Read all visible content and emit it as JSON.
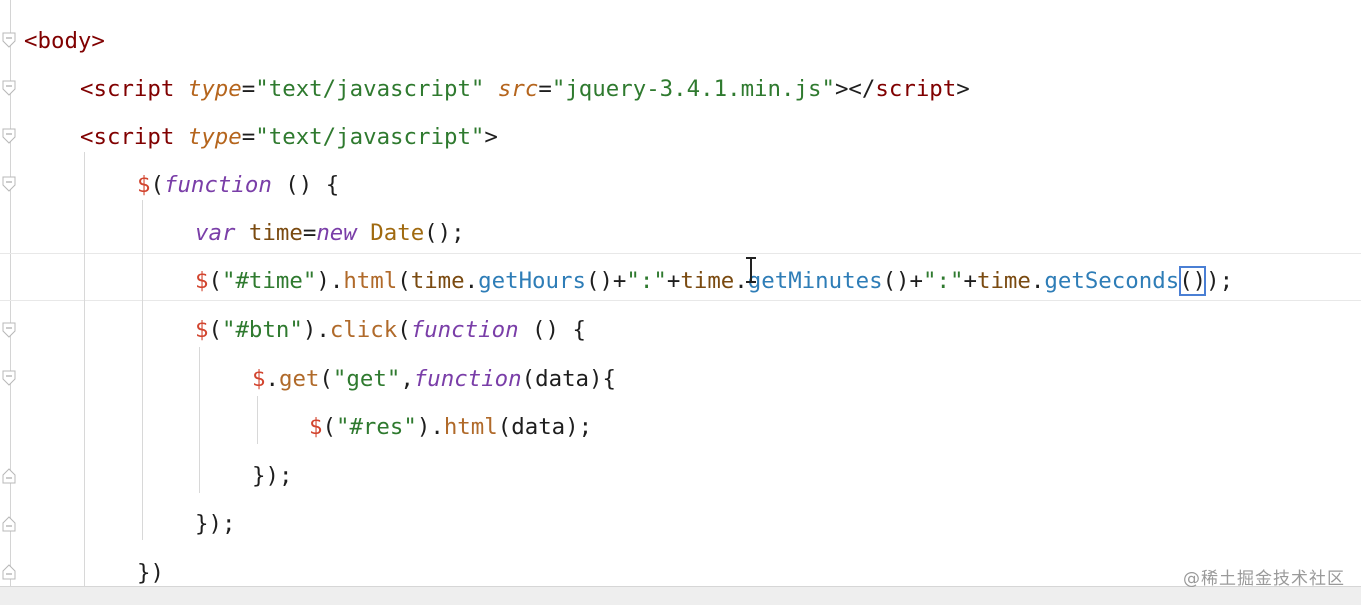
{
  "editor": {
    "lines": [
      {
        "tokens": [
          {
            "c": "t",
            "x": "<body>"
          }
        ]
      },
      {
        "tokens": [
          {
            "c": "t",
            "x": "<script "
          },
          {
            "c": "attr",
            "x": "type"
          },
          {
            "c": "p",
            "x": "="
          },
          {
            "c": "str",
            "x": "\"text/javascript\" "
          },
          {
            "c": "attr",
            "x": "src"
          },
          {
            "c": "p",
            "x": "="
          },
          {
            "c": "str",
            "x": "\"jquery-3.4.1.min.js\""
          },
          {
            "c": "p",
            "x": "></"
          },
          {
            "c": "t",
            "x": "script"
          },
          {
            "c": "p",
            "x": ">"
          }
        ]
      },
      {
        "tokens": [
          {
            "c": "t",
            "x": "<script "
          },
          {
            "c": "attr",
            "x": "type"
          },
          {
            "c": "p",
            "x": "="
          },
          {
            "c": "str",
            "x": "\"text/javascript\""
          },
          {
            "c": "p",
            "x": ">"
          }
        ]
      },
      {
        "tokens": [
          {
            "c": "dollar",
            "x": "$"
          },
          {
            "c": "p",
            "x": "("
          },
          {
            "c": "kw",
            "x": "function"
          },
          {
            "c": "p",
            "x": " () {"
          }
        ]
      },
      {
        "tokens": [
          {
            "c": "kw",
            "x": "var "
          },
          {
            "c": "var",
            "x": "time"
          },
          {
            "c": "p",
            "x": "="
          },
          {
            "c": "kw",
            "x": "new "
          },
          {
            "c": "cls",
            "x": "Date"
          },
          {
            "c": "p",
            "x": "();"
          }
        ]
      },
      {
        "tokens": [
          {
            "c": "dollar",
            "x": "$"
          },
          {
            "c": "p",
            "x": "("
          },
          {
            "c": "str",
            "x": "\"#time\""
          },
          {
            "c": "p",
            "x": ")."
          },
          {
            "c": "fn",
            "x": "html"
          },
          {
            "c": "p",
            "x": "("
          },
          {
            "c": "var",
            "x": "time"
          },
          {
            "c": "p",
            "x": "."
          },
          {
            "c": "meth",
            "x": "getHours"
          },
          {
            "c": "p",
            "x": "()+"
          },
          {
            "c": "str",
            "x": "\":\""
          },
          {
            "c": "p",
            "x": "+"
          },
          {
            "c": "var",
            "x": "time"
          },
          {
            "c": "p",
            "x": "."
          },
          {
            "c": "meth",
            "x": "getMinutes"
          },
          {
            "c": "p",
            "x": "()+"
          },
          {
            "c": "str",
            "x": "\":\""
          },
          {
            "c": "p",
            "x": "+"
          },
          {
            "c": "var",
            "x": "time"
          },
          {
            "c": "p",
            "x": "."
          },
          {
            "c": "meth",
            "x": "getSeconds"
          },
          {
            "c": "hl",
            "x": "()"
          },
          {
            "c": "p",
            "x": ");"
          }
        ]
      },
      {
        "tokens": [
          {
            "c": "dollar",
            "x": "$"
          },
          {
            "c": "p",
            "x": "("
          },
          {
            "c": "str",
            "x": "\"#btn\""
          },
          {
            "c": "p",
            "x": ")."
          },
          {
            "c": "fn",
            "x": "click"
          },
          {
            "c": "p",
            "x": "("
          },
          {
            "c": "kw",
            "x": "function"
          },
          {
            "c": "p",
            "x": " () {"
          }
        ]
      },
      {
        "tokens": [
          {
            "c": "dollar",
            "x": "$"
          },
          {
            "c": "p",
            "x": "."
          },
          {
            "c": "fn",
            "x": "get"
          },
          {
            "c": "p",
            "x": "("
          },
          {
            "c": "str",
            "x": "\"get\""
          },
          {
            "c": "p",
            "x": ","
          },
          {
            "c": "kw",
            "x": "function"
          },
          {
            "c": "p",
            "x": "(data){"
          }
        ]
      },
      {
        "tokens": [
          {
            "c": "dollar",
            "x": "$"
          },
          {
            "c": "p",
            "x": "("
          },
          {
            "c": "str",
            "x": "\"#res\""
          },
          {
            "c": "p",
            "x": ")."
          },
          {
            "c": "fn",
            "x": "html"
          },
          {
            "c": "p",
            "x": "(data);"
          }
        ]
      },
      {
        "tokens": [
          {
            "c": "p",
            "x": "});"
          }
        ]
      },
      {
        "tokens": [
          {
            "c": "p",
            "x": "});"
          }
        ]
      },
      {
        "tokens": [
          {
            "c": "p",
            "x": "})"
          }
        ]
      }
    ]
  },
  "watermark": "@稀土掘金技术社区",
  "colors": {
    "tag": "#800000",
    "attribute": "#b5651d",
    "string": "#2f7a2f",
    "keyword": "#7a3ea8",
    "dollar": "#d2452f",
    "method": "#2e7db7",
    "bracket_highlight": "#4a7fd4"
  }
}
